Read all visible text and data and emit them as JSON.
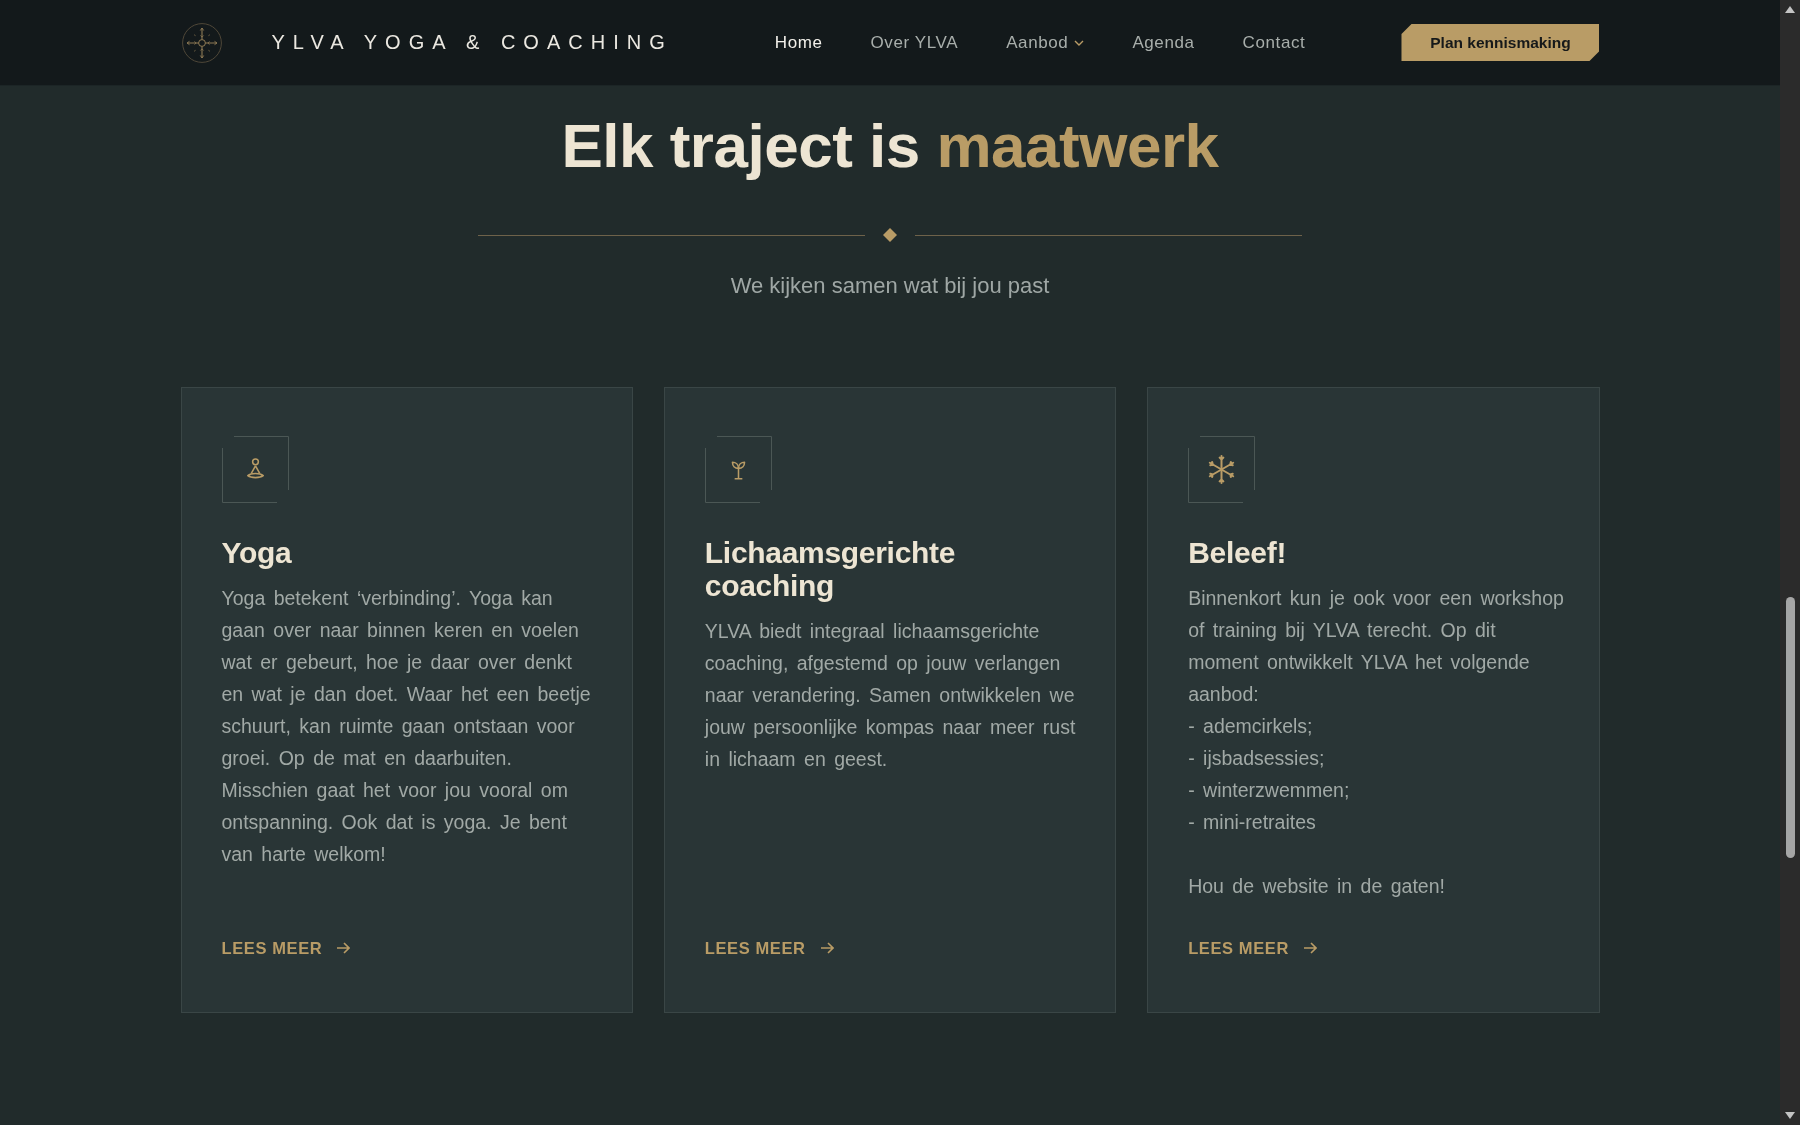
{
  "header": {
    "brand": "YLVA YOGA & COACHING",
    "nav": [
      {
        "label": "Home",
        "selected": true,
        "dropdown": false
      },
      {
        "label": "Over YLVA",
        "selected": false,
        "dropdown": false
      },
      {
        "label": "Aanbod",
        "selected": false,
        "dropdown": true
      },
      {
        "label": "Agenda",
        "selected": false,
        "dropdown": false
      },
      {
        "label": "Contact",
        "selected": false,
        "dropdown": false
      }
    ],
    "button": "Plan kennismaking"
  },
  "section": {
    "title": "Elk traject is",
    "title_highlight": "maatwerk",
    "subtitle": "We kijken samen wat bij jou past"
  },
  "cards": [
    {
      "title": "Yoga",
      "text": "Yoga betekent ‘verbinding’. Yoga kan gaan over naar binnen keren en voelen wat er gebeurt, hoe je daar over denkt en wat je dan doet. Waar het een beetje schuurt, kan ruimte gaan ontstaan voor groei. Op de mat en daarbuiten. Misschien gaat het voor jou vooral om ontspanning. Ook dat is yoga. Je bent van harte welkom!",
      "link": "LEES MEER"
    },
    {
      "title": "Lichaamsgerichte coaching",
      "text": "YLVA biedt integraal lichaamsgerichte coaching, afgestemd op jouw verlangen naar verandering. Samen ontwikkelen we jouw persoonlijke kompas naar meer rust in lichaam en geest.",
      "link": "LEES MEER"
    },
    {
      "title": "Beleef!",
      "text": "Binnenkort kun je ook voor een workshop of training bij YLVA terecht. Op dit moment ontwikkelt YLVA het volgende aanbod:\n- ademcirkels;\n- ijsbadsessies;\n- winterzwemmen;\n- mini-retraites\n\nHou de website in de gaten!",
      "link": "LEES MEER"
    }
  ]
}
